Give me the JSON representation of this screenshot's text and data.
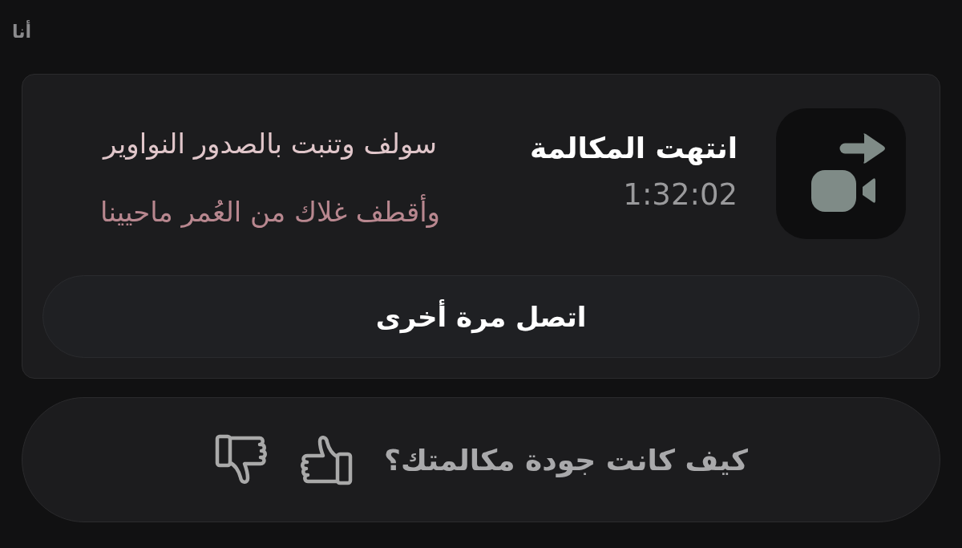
{
  "header": {
    "title": "أنا"
  },
  "call_card": {
    "title": "انتهت المكالمة",
    "duration": "1:32:02",
    "poem_lines": [
      "سولف وتنبت بالصدور النواوير",
      "وأقطف غلاك من العُمر ماحيينا"
    ],
    "call_again_button": "اتصل مرة أخرى"
  },
  "feedback": {
    "question": "كيف كانت جودة مكالمتك؟",
    "ratings": [
      {
        "kind": "thumbs_up",
        "selected": false
      },
      {
        "kind": "thumbs_down",
        "selected": false
      }
    ]
  }
}
